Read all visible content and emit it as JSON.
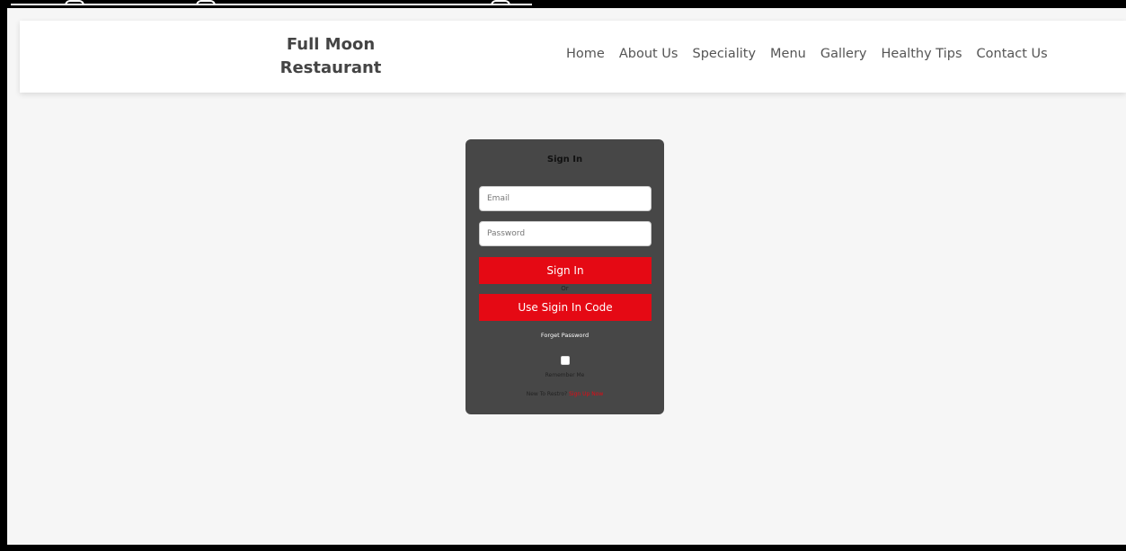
{
  "header": {
    "brand_line1": "Full Moon",
    "brand_line2": "Restaurant",
    "nav": [
      "Home",
      "About Us",
      "Speciality",
      "Menu",
      "Gallery",
      "Healthy Tips",
      "Contact Us"
    ]
  },
  "signin": {
    "title": "Sign In",
    "email_placeholder": "Email",
    "password_placeholder": "Password",
    "signin_button": "Sign In",
    "or_text": "Or",
    "code_button": "Use Sigin In Code",
    "forget_password": "Forget Password",
    "remember_me": "Remember Me",
    "new_text": "New To Restro?",
    "signup_link": "Sign Up Now"
  },
  "colors": {
    "accent": "#e50914",
    "card_bg": "#474747",
    "page_bg": "#f6f6f6"
  }
}
